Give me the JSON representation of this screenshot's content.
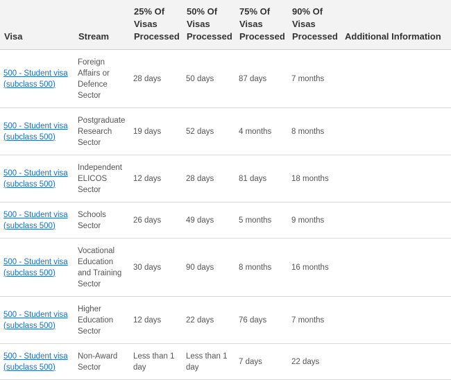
{
  "table": {
    "headers": {
      "visa": "Visa",
      "stream": "Stream",
      "p25": "25% Of Visas Processed",
      "p50": "50% Of Visas Processed",
      "p75": "75% Of Visas Processed",
      "p90": "90% Of Visas Processed",
      "info": "Additional Information"
    },
    "rows": [
      {
        "visa": "500 - Student visa (subclass 500)",
        "stream": "Foreign Affairs or Defence Sector",
        "p25": "28 days",
        "p50": "50 days",
        "p75": "87 days",
        "p90": "7 months",
        "info": ""
      },
      {
        "visa": "500 - Student visa (subclass 500)",
        "stream": "Postgraduate Research Sector",
        "p25": "19 days",
        "p50": "52 days",
        "p75": "4 months",
        "p90": "8 months",
        "info": ""
      },
      {
        "visa": "500 - Student visa (subclass 500)",
        "stream": "Independent ELICOS Sector",
        "p25": "12 days",
        "p50": "28 days",
        "p75": "81 days",
        "p90": "18 months",
        "info": ""
      },
      {
        "visa": "500 - Student visa (subclass 500)",
        "stream": "Schools Sector",
        "p25": "26 days",
        "p50": "49 days",
        "p75": "5 months",
        "p90": "9 months",
        "info": ""
      },
      {
        "visa": "500 - Student visa (subclass 500)",
        "stream": "Vocational Education and Training Sector",
        "p25": "30 days",
        "p50": "90 days",
        "p75": "8 months",
        "p90": "16 months",
        "info": ""
      },
      {
        "visa": "500 - Student visa (subclass 500)",
        "stream": "Higher Education Sector",
        "p25": "12 days",
        "p50": "22 days",
        "p75": "76 days",
        "p90": "7 months",
        "info": ""
      },
      {
        "visa": "500 - Student visa (subclass 500)",
        "stream": "Non-Award Sector",
        "p25": "Less than 1 day",
        "p50": "Less than 1 day",
        "p75": "7 days",
        "p90": "22 days",
        "info": ""
      }
    ]
  }
}
